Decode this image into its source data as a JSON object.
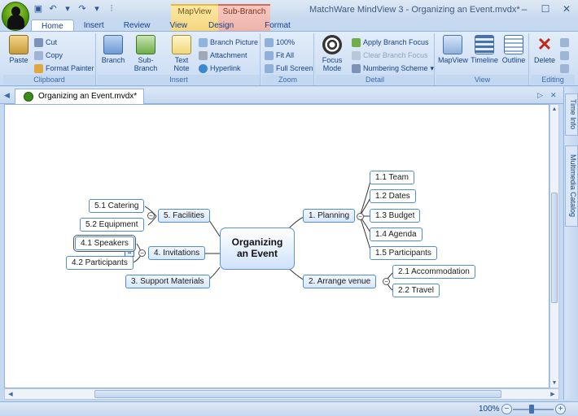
{
  "window": {
    "title": "MatchWare MindView 3 - Organizing an Event.mvdx*"
  },
  "context_tabs": {
    "mapview": "MapView",
    "subbranch": "Sub-Branch"
  },
  "tabs": [
    "Home",
    "Insert",
    "Review",
    "View",
    "Design",
    "Format"
  ],
  "ribbon": {
    "clipboard": {
      "label": "Clipboard",
      "paste": "Paste",
      "cut": "Cut",
      "copy": "Copy",
      "format_painter": "Format Painter"
    },
    "insert": {
      "label": "Insert",
      "branch": "Branch",
      "sub_branch": "Sub-Branch",
      "text_note": "Text Note",
      "branch_picture": "Branch Picture",
      "attachment": "Attachment",
      "hyperlink": "Hyperlink"
    },
    "zoom": {
      "label": "Zoom",
      "zoom100": "100%",
      "fit_all": "Fit All",
      "full_screen": "Full Screen"
    },
    "detail": {
      "label": "Detail",
      "focus_mode": "Focus Mode",
      "apply_focus": "Apply Branch Focus",
      "clear_focus": "Clear Branch Focus",
      "numbering": "Numbering Scheme"
    },
    "view": {
      "label": "View",
      "mapview": "MapView",
      "timeline": "Timeline",
      "outline": "Outline"
    },
    "editing": {
      "label": "Editing",
      "delete": "Delete"
    }
  },
  "document_tab": "Organizing an Event.mvdx*",
  "side_tabs": [
    "Time Info",
    "Multimedia Catalog"
  ],
  "mindmap": {
    "central": "Organizing an Event",
    "planning": {
      "label": "1.  Planning",
      "children": [
        "1.1  Team",
        "1.2  Dates",
        "1.3  Budget",
        "1.4  Agenda",
        "1.5  Participants"
      ]
    },
    "arrange": {
      "label": "2.  Arrange venue",
      "children": [
        "2.1  Accommodation",
        "2.2  Travel"
      ]
    },
    "support": {
      "label": "3.  Support Materials"
    },
    "invitations": {
      "label": "4.  Invitations",
      "children": [
        "4.1  Speakers",
        "4.2  Participants"
      ]
    },
    "facilities": {
      "label": "5.  Facilities",
      "children": [
        "5.1  Catering",
        "5.2  Equipment"
      ]
    }
  },
  "status": {
    "zoom": "100%"
  },
  "colors": {
    "accent": "#15428b",
    "node_border": "#4f8fcf",
    "ribbon_bg": "#dbe7f6"
  }
}
